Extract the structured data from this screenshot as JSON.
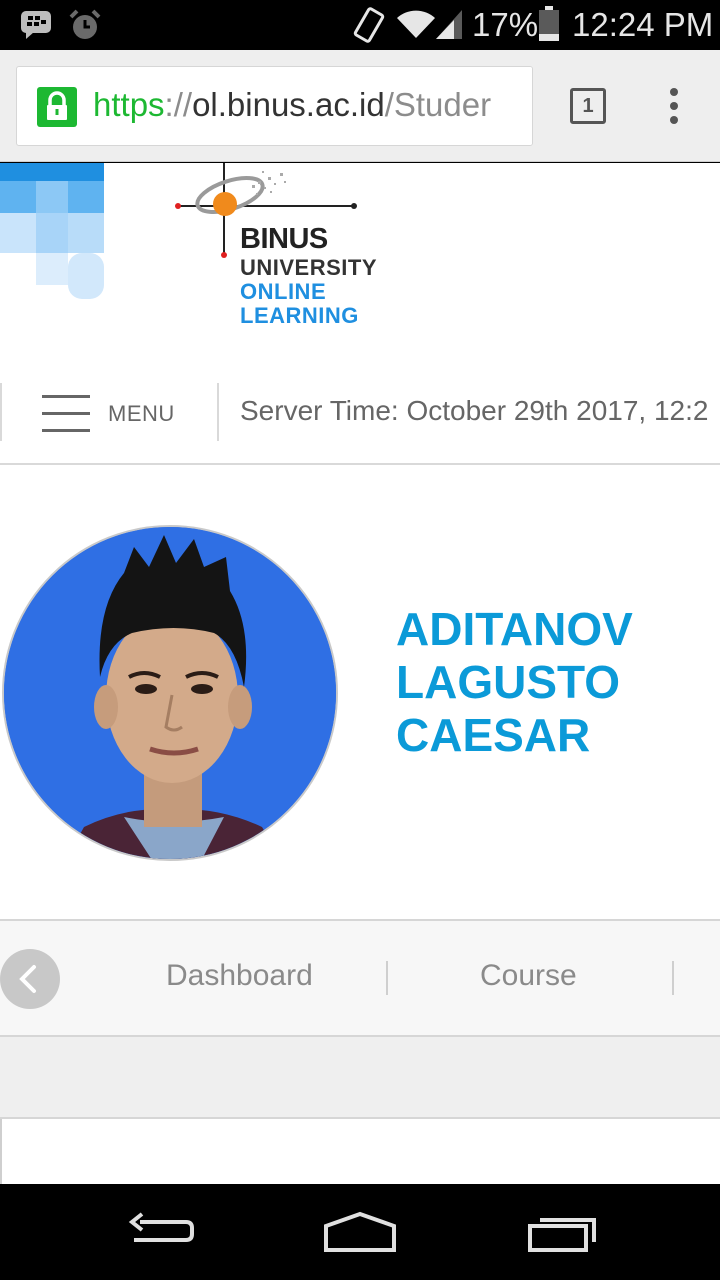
{
  "status_bar": {
    "battery": "17%",
    "time": "12:24 PM",
    "icons": [
      "blackberry-messenger-icon",
      "alarm-icon",
      "rotate-icon",
      "wifi-icon",
      "signal-icon",
      "battery-icon"
    ]
  },
  "browser": {
    "url_scheme": "https",
    "url_sep": "://",
    "url_host": "ol.binus.ac.id",
    "url_path": "/Studer",
    "tab_count": "1"
  },
  "site": {
    "logo": {
      "line1": "BINUS",
      "line2": "UNIVERSITY",
      "line3": "ONLINE",
      "line4": "LEARNING"
    },
    "menu_label": "MENU",
    "server_time": "Server Time: October 29th 2017, 12:2"
  },
  "profile": {
    "name": "ADITANOV LAGUSTO CAESAR"
  },
  "nav": {
    "items": [
      "Dashboard",
      "Course"
    ]
  },
  "colors": {
    "accent": "#0b9ad8",
    "secure": "#1db832"
  }
}
